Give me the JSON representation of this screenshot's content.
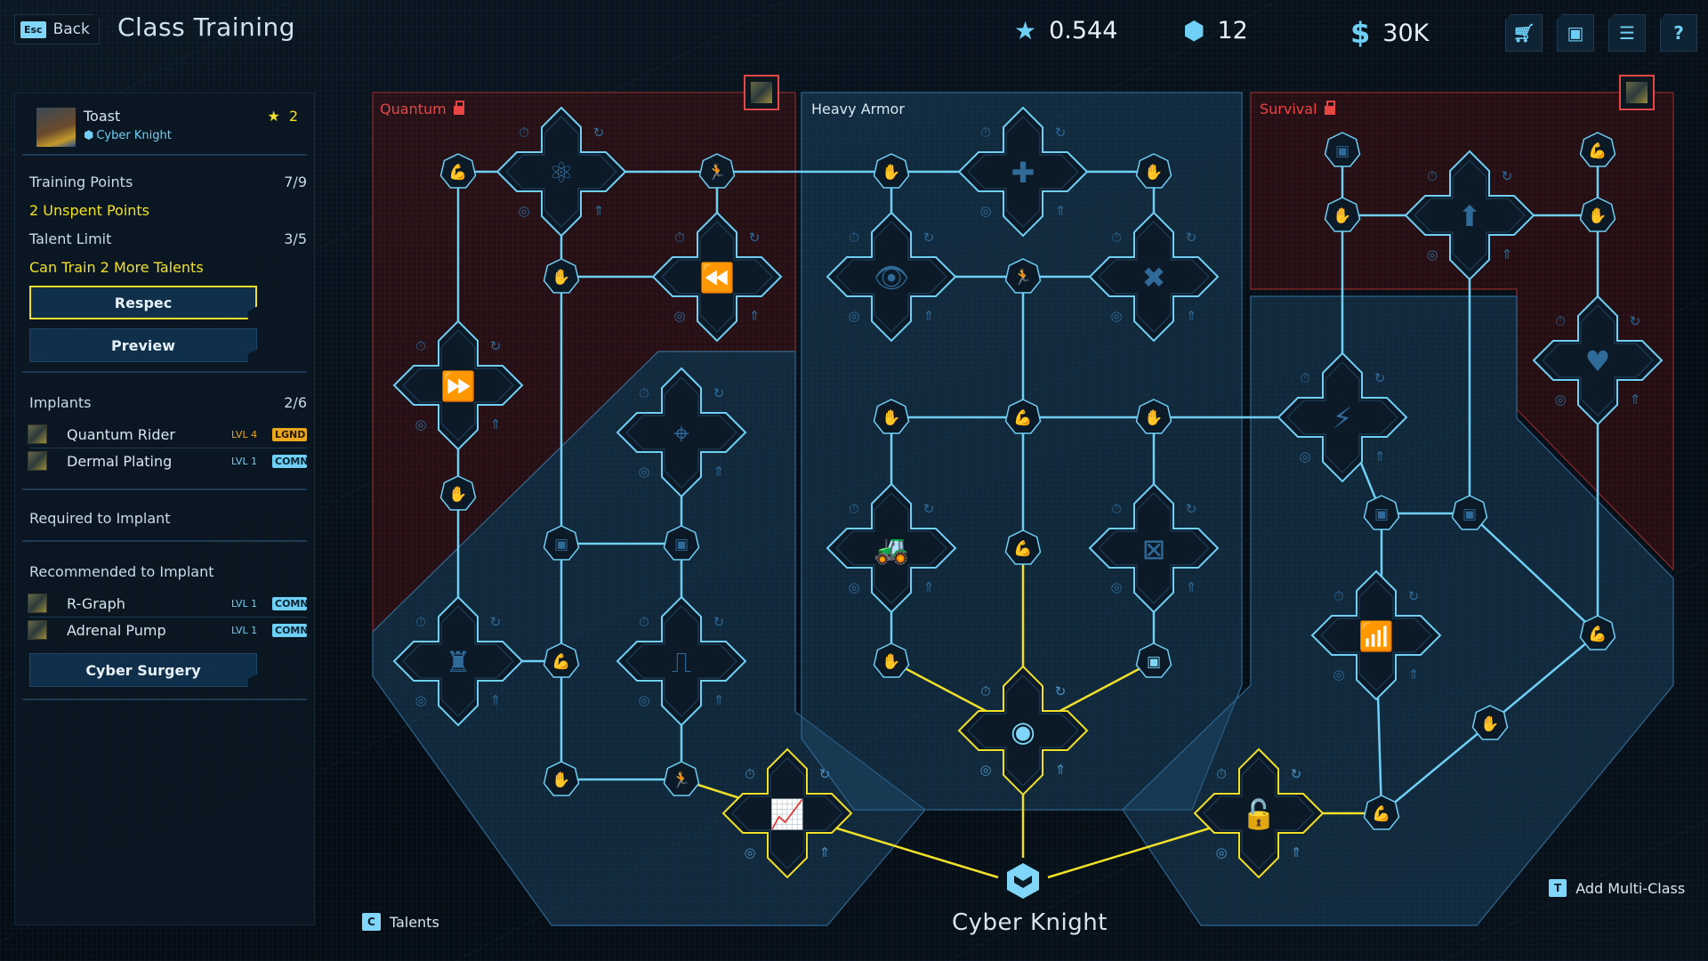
{
  "header": {
    "back_key": "Esc",
    "back_label": "Back",
    "title": "Class Training",
    "currencies": [
      {
        "icon": "rank-star-icon",
        "glyph": "★",
        "value": "0.544"
      },
      {
        "icon": "cube-icon",
        "glyph": "⬢",
        "value": "12"
      },
      {
        "icon": "credits-icon",
        "glyph": "$",
        "value": "30K"
      }
    ],
    "icons": [
      {
        "name": "shop-cart-icon",
        "glyph": "🛒"
      },
      {
        "name": "character-card-icon",
        "glyph": "▣"
      },
      {
        "name": "list-icon",
        "glyph": "☰"
      },
      {
        "name": "help-icon",
        "glyph": "?"
      }
    ]
  },
  "character": {
    "name": "Toast",
    "class": "Cyber Knight",
    "rank": "2"
  },
  "stats": {
    "training_points_label": "Training Points",
    "training_points_value": "7/9",
    "unspent": "2 Unspent Points",
    "talent_limit_label": "Talent Limit",
    "talent_limit_value": "3/5",
    "can_train": "Can Train 2 More Talents"
  },
  "buttons": {
    "respec": "Respec",
    "preview": "Preview",
    "cyber_surgery": "Cyber Surgery"
  },
  "implants": {
    "label": "Implants",
    "count": "2/6",
    "items": [
      {
        "name": "Quantum Rider",
        "level": "LVL 4",
        "rarity": "LGND"
      },
      {
        "name": "Dermal Plating",
        "level": "LVL 1",
        "rarity": "COMN"
      }
    ]
  },
  "required": {
    "label": "Required to Implant"
  },
  "recommended": {
    "label": "Recommended to Implant",
    "items": [
      {
        "name": "R-Graph",
        "level": "LVL 1",
        "rarity": "COMN"
      },
      {
        "name": "Adrenal Pump",
        "level": "LVL 1",
        "rarity": "COMN"
      }
    ]
  },
  "tree": {
    "class_name": "Cyber Knight",
    "panels": [
      {
        "name": "Quantum",
        "locked": true,
        "color": "#e84545"
      },
      {
        "name": "Heavy Armor",
        "locked": false,
        "color": "#d6e6ef"
      },
      {
        "name": "Survival",
        "locked": true,
        "color": "#e84545"
      }
    ],
    "colors": {
      "link": "#6fcff5",
      "active": "#f1e02a",
      "node_fill": "#0c1a27",
      "icon_dim": "#2f6a98",
      "icon_active": "#7fd6f8"
    },
    "nodes": [
      {
        "id": "q1",
        "kind": "stat",
        "icon": "arm-icon",
        "state": "available"
      },
      {
        "id": "q2",
        "kind": "talent",
        "icon": "atom-pause-icon",
        "state": "available"
      },
      {
        "id": "q3",
        "kind": "stat",
        "icon": "run-icon",
        "state": "available"
      },
      {
        "id": "q4",
        "kind": "stat",
        "icon": "hand-icon",
        "state": "available"
      },
      {
        "id": "q5",
        "kind": "talent",
        "icon": "rewind-icon",
        "state": "available"
      },
      {
        "id": "q6",
        "kind": "talent",
        "icon": "fast-forward-icon",
        "state": "available"
      },
      {
        "id": "q7",
        "kind": "stat",
        "icon": "hand-icon",
        "state": "available"
      },
      {
        "id": "q8",
        "kind": "talent",
        "icon": "target-icon",
        "state": "available"
      },
      {
        "id": "q9",
        "kind": "stat",
        "icon": "chip-icon",
        "state": "available"
      },
      {
        "id": "q10",
        "kind": "stat",
        "icon": "chip-icon",
        "state": "available"
      },
      {
        "id": "q11",
        "kind": "talent",
        "icon": "rook-network-icon",
        "state": "available"
      },
      {
        "id": "q12",
        "kind": "stat",
        "icon": "arm-icon",
        "state": "available"
      },
      {
        "id": "q13",
        "kind": "talent",
        "icon": "waveform-icon",
        "state": "available"
      },
      {
        "id": "q14",
        "kind": "stat",
        "icon": "hand-icon",
        "state": "available"
      },
      {
        "id": "q15",
        "kind": "stat",
        "icon": "run-icon",
        "state": "active"
      },
      {
        "id": "q16",
        "kind": "talent",
        "icon": "chip-upgrade-chart-icon",
        "state": "active"
      },
      {
        "id": "h1",
        "kind": "stat",
        "icon": "hand-icon",
        "state": "available"
      },
      {
        "id": "h2",
        "kind": "talent",
        "icon": "medkit-icon",
        "state": "available"
      },
      {
        "id": "h3",
        "kind": "stat",
        "icon": "hand-icon",
        "state": "available"
      },
      {
        "id": "h4",
        "kind": "talent",
        "icon": "eye-icon",
        "state": "available"
      },
      {
        "id": "h5",
        "kind": "stat",
        "icon": "run-icon",
        "state": "available"
      },
      {
        "id": "h6",
        "kind": "talent",
        "icon": "bandage-icon",
        "state": "available"
      },
      {
        "id": "h7",
        "kind": "stat",
        "icon": "hand-icon",
        "state": "available"
      },
      {
        "id": "h8",
        "kind": "stat",
        "icon": "arm-icon",
        "state": "available"
      },
      {
        "id": "h9",
        "kind": "stat",
        "icon": "hand-icon",
        "state": "available"
      },
      {
        "id": "h10",
        "kind": "talent",
        "icon": "roller-icon",
        "state": "available"
      },
      {
        "id": "h11",
        "kind": "stat",
        "icon": "arm-icon",
        "state": "active"
      },
      {
        "id": "h12",
        "kind": "talent",
        "icon": "compress-icon",
        "state": "available"
      },
      {
        "id": "h13",
        "kind": "stat",
        "icon": "hand-icon",
        "state": "active"
      },
      {
        "id": "h14",
        "kind": "stat",
        "icon": "chip-icon",
        "state": "active"
      },
      {
        "id": "h15",
        "kind": "talent",
        "icon": "atom-eye-icon",
        "state": "active"
      },
      {
        "id": "s1",
        "kind": "stat",
        "icon": "chip-icon",
        "state": "available"
      },
      {
        "id": "s2",
        "kind": "stat",
        "icon": "arm-icon",
        "state": "available"
      },
      {
        "id": "s3",
        "kind": "stat",
        "icon": "hand-icon",
        "state": "available"
      },
      {
        "id": "s4",
        "kind": "talent",
        "icon": "arrow-up-icon",
        "state": "available"
      },
      {
        "id": "s5",
        "kind": "stat",
        "icon": "hand-icon",
        "state": "available"
      },
      {
        "id": "s6",
        "kind": "talent",
        "icon": "heartbeat-icon",
        "state": "available"
      },
      {
        "id": "s7",
        "kind": "talent",
        "icon": "shock-icon",
        "state": "available"
      },
      {
        "id": "s8",
        "kind": "stat",
        "icon": "chip-icon",
        "state": "available"
      },
      {
        "id": "s9",
        "kind": "stat",
        "icon": "chip-icon",
        "state": "available"
      },
      {
        "id": "s10",
        "kind": "talent",
        "icon": "signal-jam-icon",
        "state": "available"
      },
      {
        "id": "s11",
        "kind": "stat",
        "icon": "arm-icon",
        "state": "available"
      },
      {
        "id": "s12",
        "kind": "stat",
        "icon": "hand-icon",
        "state": "available"
      },
      {
        "id": "s13",
        "kind": "stat",
        "icon": "arm-icon",
        "state": "active"
      },
      {
        "id": "s14",
        "kind": "talent",
        "icon": "unlock-icon",
        "state": "active"
      }
    ]
  },
  "hints": {
    "talents_key": "C",
    "talents_label": "Talents",
    "multiclass_key": "T",
    "multiclass_label": "Add Multi-Class"
  }
}
